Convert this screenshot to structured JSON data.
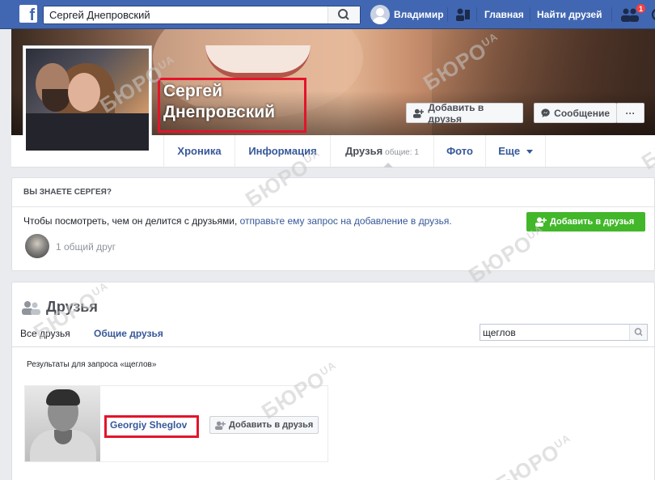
{
  "topbar": {
    "search_value": "Сергей Днепровский",
    "user_name": "Владимир",
    "home": "Главная",
    "find_friends": "Найти друзей",
    "notification_count": "1"
  },
  "profile": {
    "name_line1": "Сергей",
    "name_line2": "Днепровский",
    "add_friend": "Добавить в друзья",
    "message": "Сообщение",
    "more": "···"
  },
  "tabs": {
    "timeline": "Хроника",
    "about": "Информация",
    "friends": "Друзья",
    "friends_count": "общие: 1",
    "photos": "Фото",
    "more": "Еще"
  },
  "know": {
    "title": "ВЫ ЗНАЕТЕ СЕРГЕЯ?",
    "text_prefix": "Чтобы посмотреть, чем он делится с друзьями,",
    "text_link": "отправьте ему запрос на добавление в друзья.",
    "add_button": "Добавить в друзья",
    "mutual": "1 общий друг"
  },
  "friends": {
    "title": "Друзья",
    "tab_all": "Все друзья",
    "tab_common": "Общие друзья",
    "search_value": "щеглов",
    "results_label": "Результаты для запроса «щеглов»",
    "result_name": "Georgiy Sheglov",
    "result_add": "Добавить в друзья"
  },
  "watermark": {
    "text": "БЮРО",
    "suffix": "UA"
  },
  "colors": {
    "fb_blue": "#4267b2",
    "link": "#365899",
    "green": "#42b72a",
    "highlight_red": "#e4142b"
  }
}
